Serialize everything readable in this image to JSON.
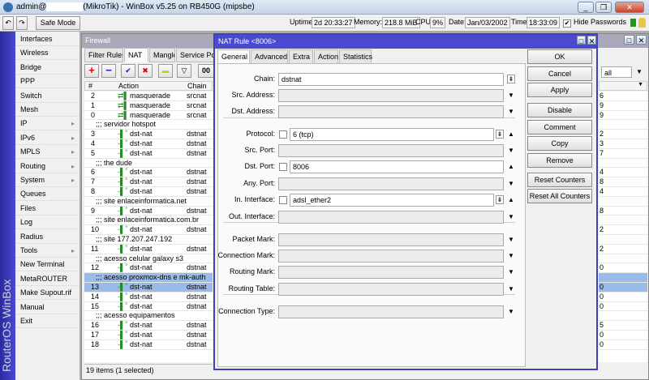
{
  "title": {
    "user": "admin@",
    "router": "(MikroTik) - WinBox v5.25 on RB450G (mipsbe)"
  },
  "toolbar": {
    "safe_mode": "Safe Mode",
    "uptime_label": "Uptime:",
    "uptime": "2d 20:33:27",
    "memory_label": "Memory:",
    "memory": "218.8 MiB",
    "cpu_label": "CPU:",
    "cpu": "9%",
    "date_label": "Date:",
    "date": "Jan/03/2002",
    "time_label": "Time:",
    "time": "18:33:09",
    "hide_passwords": "Hide Passwords",
    "hide_passwords_checked": true
  },
  "sidebar": {
    "brand": "RouterOS WinBox",
    "items": [
      {
        "label": "Interfaces"
      },
      {
        "label": "Wireless"
      },
      {
        "label": "Bridge"
      },
      {
        "label": "PPP"
      },
      {
        "label": "Switch"
      },
      {
        "label": "Mesh"
      },
      {
        "label": "IP",
        "sub": true
      },
      {
        "label": "IPv6",
        "sub": true
      },
      {
        "label": "MPLS",
        "sub": true
      },
      {
        "label": "Routing",
        "sub": true
      },
      {
        "label": "System",
        "sub": true
      },
      {
        "label": "Queues"
      },
      {
        "label": "Files"
      },
      {
        "label": "Log"
      },
      {
        "label": "Radius"
      },
      {
        "label": "Tools",
        "sub": true
      },
      {
        "label": "New Terminal"
      },
      {
        "label": "MetaROUTER"
      },
      {
        "label": "Make Supout.rif"
      },
      {
        "label": "Manual"
      },
      {
        "label": "Exit"
      }
    ]
  },
  "firewall": {
    "title": "Firewall",
    "tabs": [
      "Filter Rules",
      "NAT",
      "Mangle",
      "Service Por"
    ],
    "active_tab": 1,
    "filter_value": "all",
    "columns": [
      "#",
      "Action",
      "Chain"
    ],
    "status": "19 items (1 selected)",
    "rows": [
      {
        "n": "2",
        "action": "masquerade",
        "chain": "srcnat",
        "extra": "6"
      },
      {
        "n": "1",
        "action": "masquerade",
        "chain": "srcnat",
        "extra": "9"
      },
      {
        "n": "0",
        "action": "masquerade",
        "chain": "srcnat",
        "extra": "9"
      },
      {
        "comment": ";;; servidor hotspot"
      },
      {
        "n": "3",
        "action": "dst-nat",
        "chain": "dstnat",
        "extra": "2"
      },
      {
        "n": "4",
        "action": "dst-nat",
        "chain": "dstnat",
        "extra": "3"
      },
      {
        "n": "5",
        "action": "dst-nat",
        "chain": "dstnat",
        "extra": "7"
      },
      {
        "comment": ";;; the dude"
      },
      {
        "n": "6",
        "action": "dst-nat",
        "chain": "dstnat",
        "extra": "4"
      },
      {
        "n": "7",
        "action": "dst-nat",
        "chain": "dstnat",
        "extra": "8"
      },
      {
        "n": "8",
        "action": "dst-nat",
        "chain": "dstnat",
        "extra": "4"
      },
      {
        "comment": ";;; site enlaceinformatica.net"
      },
      {
        "n": "9",
        "action": "dst-nat",
        "chain": "dstnat",
        "extra": "8"
      },
      {
        "comment": ";;; site enlaceinformatica.com.br"
      },
      {
        "n": "10",
        "action": "dst-nat",
        "chain": "dstnat",
        "extra": "2"
      },
      {
        "comment": ";;; site 177.207.247.192"
      },
      {
        "n": "11",
        "action": "dst-nat",
        "chain": "dstnat",
        "extra": "2"
      },
      {
        "comment": ";;; acesso celular galaxy s3"
      },
      {
        "n": "12",
        "action": "dst-nat",
        "chain": "dstnat",
        "extra": "0"
      },
      {
        "comment": ";;; acesso proxmox-dns e mk-auth",
        "selected": true
      },
      {
        "n": "13",
        "action": "dst-nat",
        "chain": "dstnat",
        "extra": "0",
        "selected": true
      },
      {
        "n": "14",
        "action": "dst-nat",
        "chain": "dstnat",
        "extra": "0"
      },
      {
        "n": "15",
        "action": "dst-nat",
        "chain": "dstnat",
        "extra": "0"
      },
      {
        "comment": ";;; acesso equipamentos"
      },
      {
        "n": "16",
        "action": "dst-nat",
        "chain": "dstnat",
        "extra": "5"
      },
      {
        "n": "17",
        "action": "dst-nat",
        "chain": "dstnat",
        "extra": "0"
      },
      {
        "n": "18",
        "action": "dst-nat",
        "chain": "dstnat",
        "extra": "0"
      }
    ]
  },
  "dialog": {
    "title": "NAT Rule <8006>",
    "tabs": [
      "General",
      "Advanced",
      "Extra",
      "Action",
      "Statistics"
    ],
    "fields": {
      "chain": {
        "label": "Chain:",
        "value": "dstnat"
      },
      "src_address": {
        "label": "Src. Address:"
      },
      "dst_address": {
        "label": "Dst. Address:"
      },
      "protocol": {
        "label": "Protocol:",
        "value": "6 (tcp)"
      },
      "src_port": {
        "label": "Src. Port:"
      },
      "dst_port": {
        "label": "Dst. Port:",
        "value": "8006"
      },
      "any_port": {
        "label": "Any. Port:"
      },
      "in_interface": {
        "label": "In. Interface:",
        "value": "adsl_ether2"
      },
      "out_interface": {
        "label": "Out. Interface:"
      },
      "packet_mark": {
        "label": "Packet Mark:"
      },
      "connection_mark": {
        "label": "Connection Mark:"
      },
      "routing_mark": {
        "label": "Routing Mark:"
      },
      "routing_table": {
        "label": "Routing Table:"
      },
      "connection_type": {
        "label": "Connection Type:"
      }
    },
    "buttons": [
      "OK",
      "Cancel",
      "Apply",
      "Disable",
      "Comment",
      "Copy",
      "Remove",
      "Reset Counters",
      "Reset All Counters"
    ]
  }
}
